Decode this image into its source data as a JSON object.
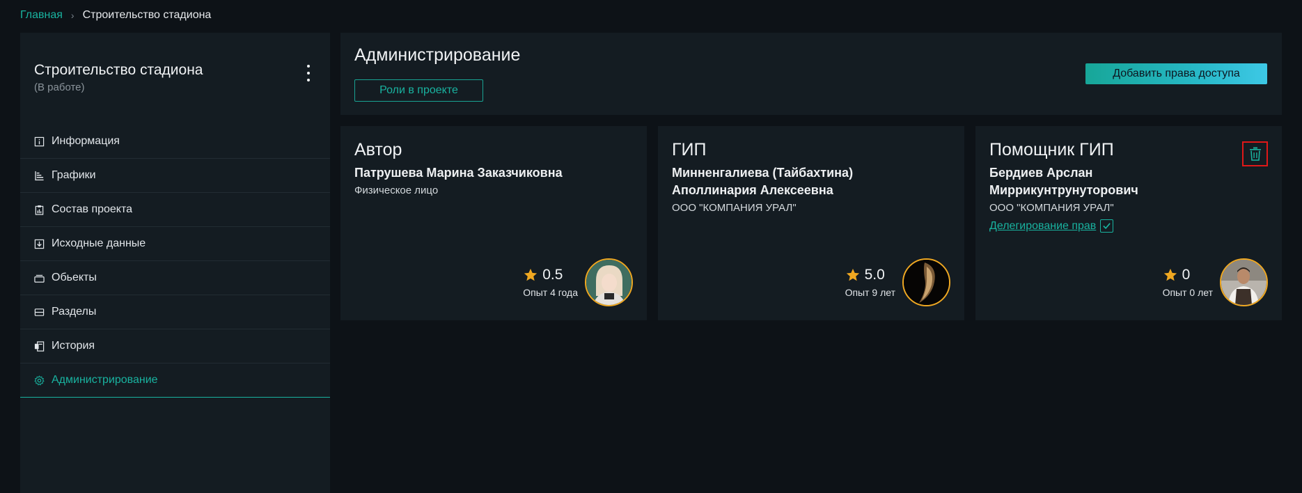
{
  "breadcrumb": {
    "home": "Главная",
    "separator": "›",
    "current": "Строительство стадиона"
  },
  "sidebar": {
    "title": "Строительство стадиона",
    "status": "(В работе)",
    "items": [
      {
        "label": "Информация",
        "icon": "info-icon"
      },
      {
        "label": "Графики",
        "icon": "chart-icon"
      },
      {
        "label": "Состав проекта",
        "icon": "clipboard-icon"
      },
      {
        "label": "Исходные данные",
        "icon": "download-icon"
      },
      {
        "label": "Обьекты",
        "icon": "objects-icon"
      },
      {
        "label": "Разделы",
        "icon": "sections-icon"
      },
      {
        "label": "История",
        "icon": "history-icon"
      },
      {
        "label": "Администрирование",
        "icon": "gear-icon",
        "active": true
      }
    ]
  },
  "header": {
    "title": "Администрирование",
    "roles_button": "Роли в проекте",
    "add_button": "Добавить права доступа"
  },
  "cards": [
    {
      "role": "Автор",
      "name": "Патрушева Марина Заказчиковна",
      "org": "Физическое лицо",
      "rating": "0.5",
      "experience": "Опыт 4 года"
    },
    {
      "role": "ГИП",
      "name": "Минненгалиева (Тайбахтина) Аполлинария Алексеевна",
      "org": "ООО \"КОМПАНИЯ УРАЛ\"",
      "rating": "5.0",
      "experience": "Опыт 9 лет"
    },
    {
      "role": "Помощник ГИП",
      "name": "Бердиев Арслан Миррикунтрунуторович",
      "org": "ООО \"КОМПАНИЯ УРАЛ\"",
      "delegation": "Делегирование прав",
      "delegation_checked": true,
      "rating": "0",
      "experience": "Опыт 0 лет"
    }
  ],
  "colors": {
    "accent": "#19b3a0",
    "star": "#f0a821",
    "delete_highlight": "#e01818",
    "background": "#0d1217",
    "panel": "#141c22"
  }
}
